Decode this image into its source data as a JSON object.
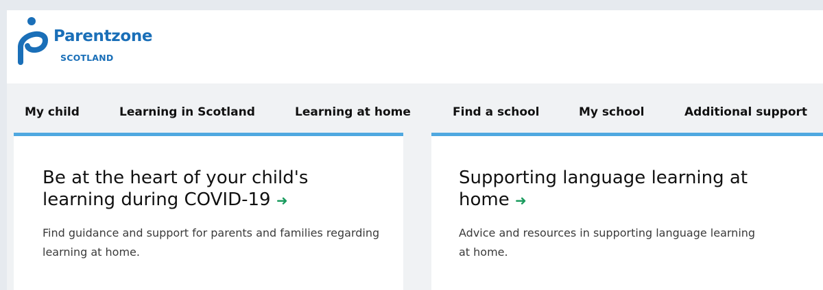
{
  "brand": {
    "name": "Parentzone",
    "region": "SCOTLAND",
    "color": "#1a6fb8"
  },
  "nav": {
    "items": [
      {
        "label": "My child"
      },
      {
        "label": "Learning in Scotland"
      },
      {
        "label": "Learning at home"
      },
      {
        "label": "Find a school"
      },
      {
        "label": "My school"
      },
      {
        "label": "Additional support"
      }
    ]
  },
  "cards": [
    {
      "title": "Be at the heart of your child's learning during COVID-19",
      "arrow": "➜",
      "description": "Find guidance and support for parents and families regarding learning at home."
    },
    {
      "title": "Supporting language learning at home",
      "arrow": "➜",
      "description": "Advice and resources in supporting language learning at home."
    }
  ],
  "colors": {
    "accent": "#4fa8e0",
    "arrow": "#1a9b5e",
    "background": "#e6eaef"
  }
}
